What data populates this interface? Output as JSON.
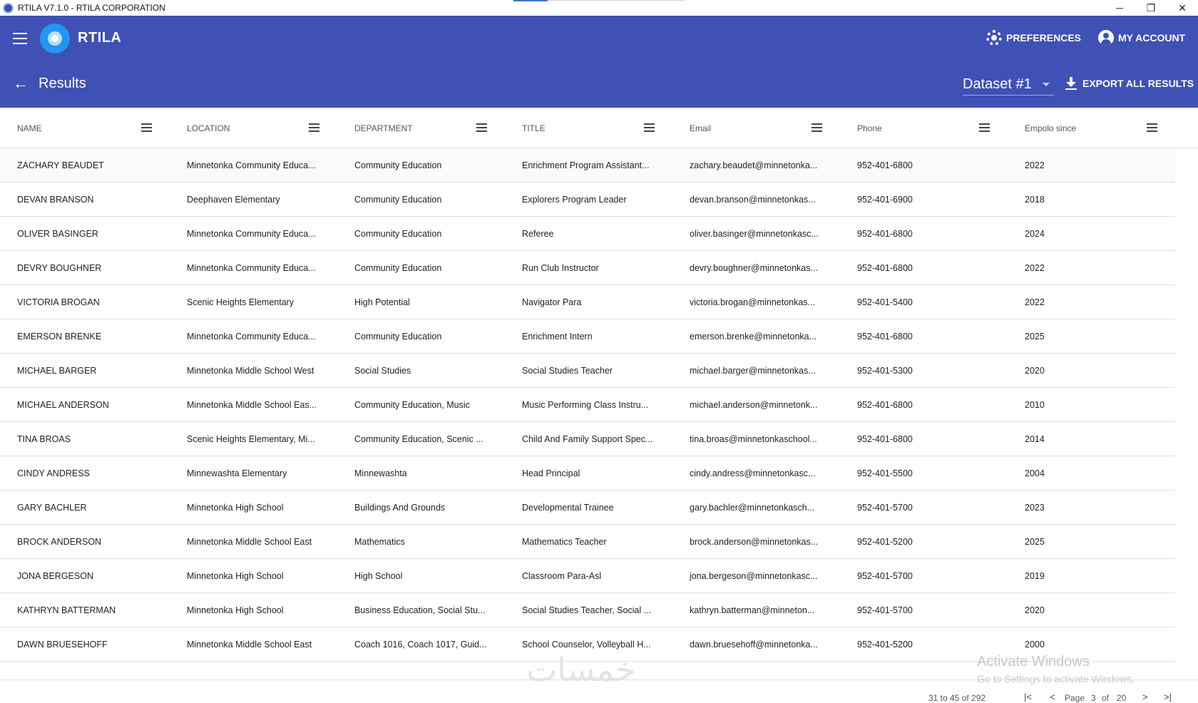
{
  "window": {
    "title": "RTILA V7.1.0 - RTILA CORPORATION",
    "minimize": "─",
    "restore": "❐",
    "close": "✕"
  },
  "header": {
    "brand": "RTILA",
    "preferences_label": "PREFERENCES",
    "account_label": "MY ACCOUNT"
  },
  "subheader": {
    "back": "←",
    "page_title": "Results",
    "dataset_value": "Dataset #1",
    "export_label": "EXPORT ALL RESULTS"
  },
  "table": {
    "columns": [
      "NAME",
      "LOCATION",
      "DEPARTMENT",
      "TITLE",
      "Email",
      "Phone",
      "Empolo since"
    ],
    "rows": [
      [
        "ZACHARY BEAUDET",
        "Minnetonka Community Educa...",
        "Community Education",
        "Enrichment Program Assistant...",
        "zachary.beaudet@minnetonka...",
        "952-401-6800",
        "2022"
      ],
      [
        "DEVAN BRANSON",
        "Deephaven Elementary",
        "Community Education",
        "Explorers Program Leader",
        "devan.branson@minnetonkas...",
        "952-401-6900",
        "2018"
      ],
      [
        "OLIVER BASINGER",
        "Minnetonka Community Educa...",
        "Community Education",
        "Referee",
        "oliver.basinger@minnetonkasc...",
        "952-401-6800",
        "2024"
      ],
      [
        "DEVRY BOUGHNER",
        "Minnetonka Community Educa...",
        "Community Education",
        "Run Club Instructor",
        "devry.boughner@minnetonkas...",
        "952-401-6800",
        "2022"
      ],
      [
        "VICTORIA BROGAN",
        "Scenic Heights Elementary",
        "High Potential",
        "Navigator Para",
        "victoria.brogan@minnetonkas...",
        "952-401-5400",
        "2022"
      ],
      [
        "EMERSON BRENKE",
        "Minnetonka Community Educa...",
        "Community Education",
        "Enrichment Intern",
        "emerson.brenke@minnetonka...",
        "952-401-6800",
        "2025"
      ],
      [
        "MICHAEL BARGER",
        "Minnetonka Middle School West",
        "Social Studies",
        "Social Studies Teacher",
        "michael.barger@minnetonkas...",
        "952-401-5300",
        "2020"
      ],
      [
        "MICHAEL ANDERSON",
        "Minnetonka Middle School Eas...",
        "Community Education, Music",
        "Music Performing Class Instru...",
        "michael.anderson@minnetonk...",
        "952-401-6800",
        "2010"
      ],
      [
        "TINA BROAS",
        "Scenic Heights Elementary, Mi...",
        "Community Education, Scenic ...",
        "Child And Family Support Spec...",
        "tina.broas@minnetonkaschool...",
        "952-401-6800",
        "2014"
      ],
      [
        "CINDY ANDRESS",
        "Minnewashta Elementary",
        "Minnewashta",
        "Head Principal",
        "cindy.andress@minnetonkasc...",
        "952-401-5500",
        "2004"
      ],
      [
        "GARY BACHLER",
        "Minnetonka High School",
        "Buildings And Grounds",
        "Developmental Trainee",
        "gary.bachler@minnetonkasch...",
        "952-401-5700",
        "2023"
      ],
      [
        "BROCK ANDERSON",
        "Minnetonka Middle School East",
        "Mathematics",
        "Mathematics Teacher",
        "brock.anderson@minnetonkas...",
        "952-401-5200",
        "2025"
      ],
      [
        "JONA BERGESON",
        "Minnetonka High School",
        "High School",
        "Classroom Para-Asl",
        "jona.bergeson@minnetonkasc...",
        "952-401-5700",
        "2019"
      ],
      [
        "KATHRYN BATTERMAN",
        "Minnetonka High School",
        "Business Education, Social Stu...",
        "Social Studies Teacher, Social ...",
        "kathryn.batterman@minneton...",
        "952-401-5700",
        "2020"
      ],
      [
        "DAWN BRUESEHOFF",
        "Minnetonka Middle School East",
        "Coach 1016, Coach 1017, Guid...",
        "School Counselor, Volleyball H...",
        "dawn.bruesehoff@minnetonka...",
        "952-401-5200",
        "2000"
      ]
    ]
  },
  "pagination": {
    "range_text": "31 to 45 of 292",
    "page_word": "Page",
    "current_page": "3",
    "of_word": "of",
    "total_pages": "20",
    "first": "|<",
    "prev": "<",
    "next": ">",
    "last": ">|"
  },
  "overlay": {
    "activate_title": "Activate Windows",
    "activate_sub": "Go to Settings to activate Windows.",
    "brand_mark": "خمسات"
  },
  "colors": {
    "appbar": "#3f51b5",
    "logo": "#2196f3"
  }
}
